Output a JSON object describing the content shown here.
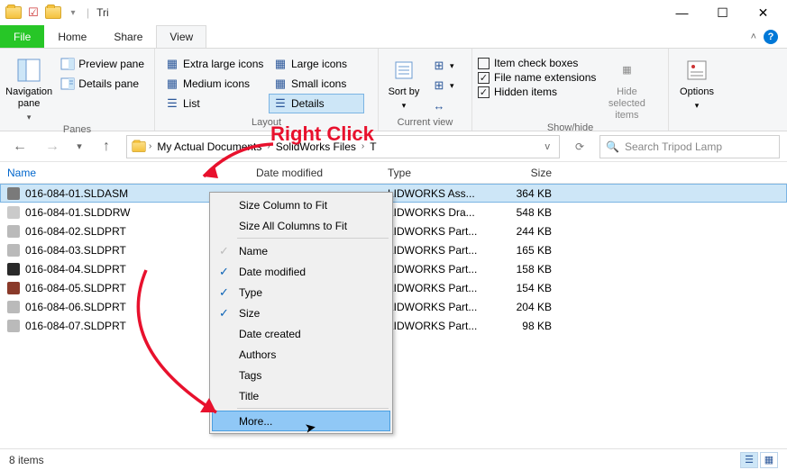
{
  "window": {
    "title_cut": "Tri"
  },
  "tabs": {
    "file": "File",
    "home": "Home",
    "share": "Share",
    "view": "View"
  },
  "ribbon": {
    "panes": {
      "nav": "Navigation pane",
      "preview": "Preview pane",
      "details": "Details pane",
      "group": "Panes"
    },
    "layout": {
      "xl": "Extra large icons",
      "large": "Large icons",
      "medium": "Medium icons",
      "small": "Small icons",
      "list": "List",
      "details": "Details",
      "group": "Layout"
    },
    "current": {
      "sort": "Sort by",
      "group": "Current view"
    },
    "showhide": {
      "checkboxes": "Item check boxes",
      "ext": "File name extensions",
      "hidden": "Hidden items",
      "hidesel": "Hide selected items",
      "group": "Show/hide"
    },
    "options": "Options"
  },
  "breadcrumb": {
    "seg1": "My Actual Documents",
    "seg2": "SolidWorks Files",
    "seg3": "T",
    "dropdown_v": "v"
  },
  "search": {
    "placeholder": "Search Tripod Lamp"
  },
  "columns": {
    "name": "Name",
    "date": "Date modified",
    "type": "Type",
    "size": "Size"
  },
  "files": [
    {
      "name": "016-084-01.SLDASM",
      "type": "LIDWORKS Ass...",
      "size": "364 KB",
      "icon": "#7a7a7a"
    },
    {
      "name": "016-084-01.SLDDRW",
      "type": "LIDWORKS Dra...",
      "size": "548 KB",
      "icon": "#cacaca"
    },
    {
      "name": "016-084-02.SLDPRT",
      "type": "LIDWORKS Part...",
      "size": "244 KB",
      "icon": "#bababa"
    },
    {
      "name": "016-084-03.SLDPRT",
      "type": "LIDWORKS Part...",
      "size": "165 KB",
      "icon": "#bababa"
    },
    {
      "name": "016-084-04.SLDPRT",
      "type": "LIDWORKS Part...",
      "size": "158 KB",
      "icon": "#2a2a2a"
    },
    {
      "name": "016-084-05.SLDPRT",
      "type": "LIDWORKS Part...",
      "size": "154 KB",
      "icon": "#8a3a2a"
    },
    {
      "name": "016-084-06.SLDPRT",
      "type": "LIDWORKS Part...",
      "size": "204 KB",
      "icon": "#bababa"
    },
    {
      "name": "016-084-07.SLDPRT",
      "type": "LIDWORKS Part...",
      "size": "98 KB",
      "icon": "#bababa"
    }
  ],
  "context_menu": {
    "fit": "Size Column to Fit",
    "fitall": "Size All Columns to Fit",
    "name": "Name",
    "date": "Date modified",
    "type": "Type",
    "size": "Size",
    "created": "Date created",
    "authors": "Authors",
    "tags": "Tags",
    "title": "Title",
    "more": "More..."
  },
  "annotation": {
    "text": "Right Click"
  },
  "status": {
    "count": "8 items"
  }
}
